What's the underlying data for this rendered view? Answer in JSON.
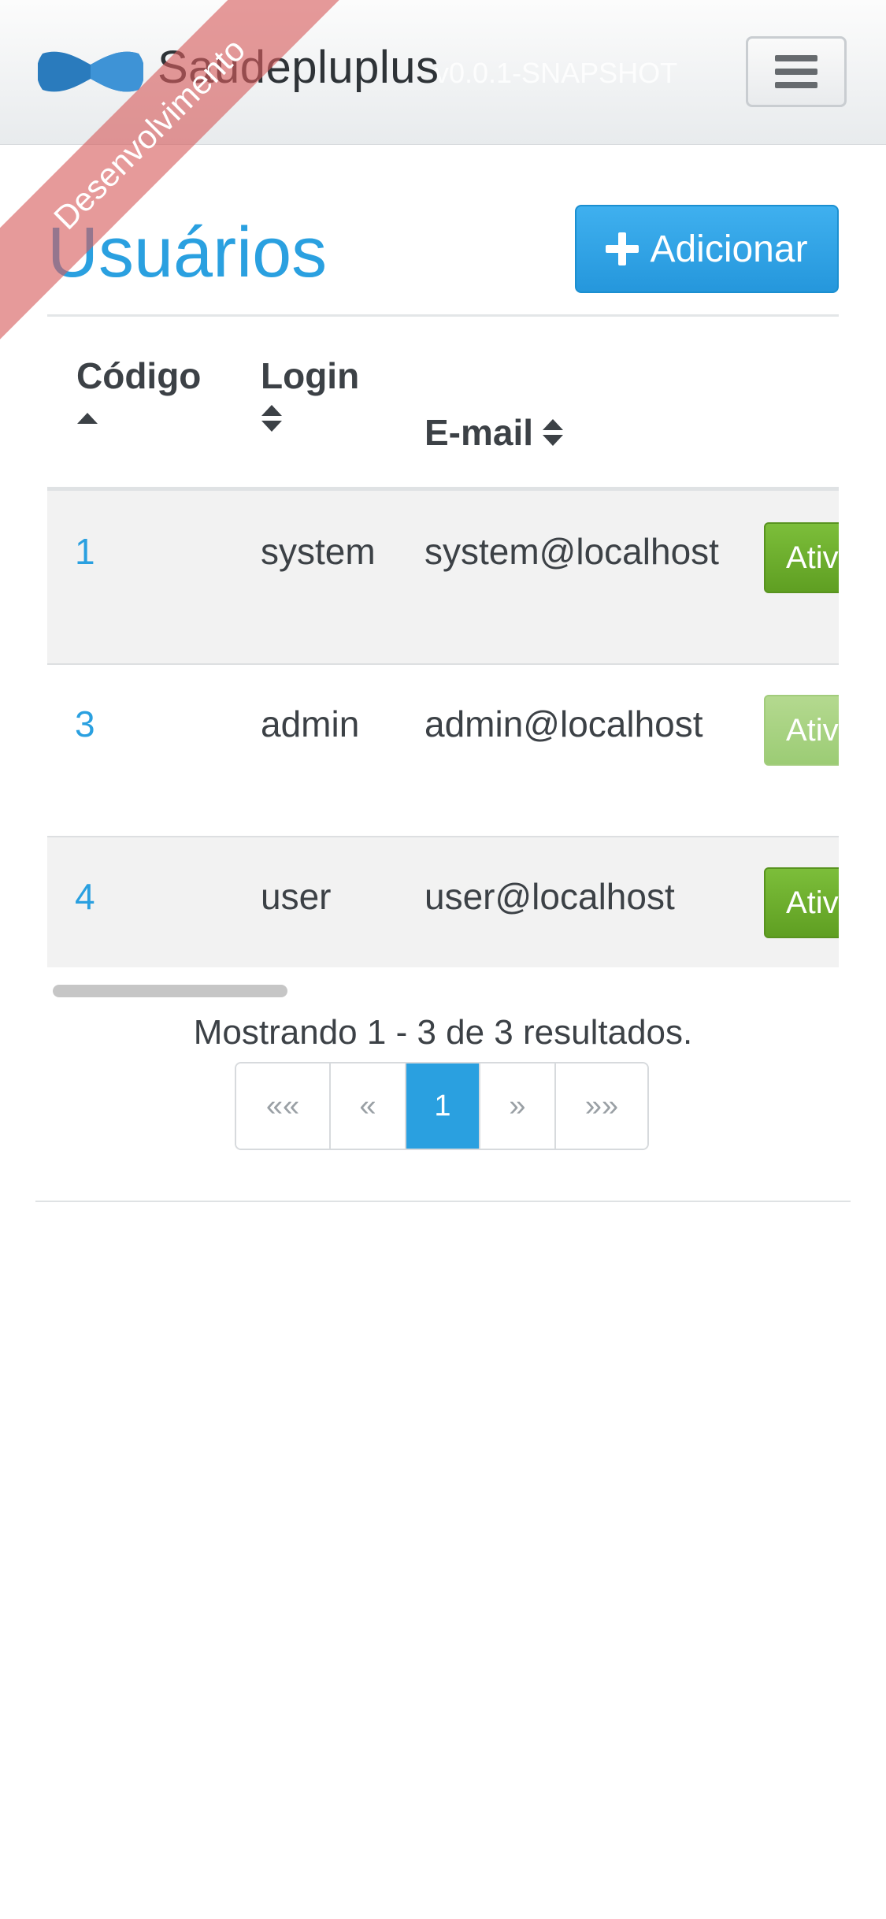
{
  "navbar": {
    "brand": "Saudepluplus",
    "version": "v0.0.1-SNAPSHOT",
    "logo_icon": "bowtie-logo-icon",
    "menu_icon": "hamburger-menu-icon"
  },
  "ribbon": {
    "text": "Desenvolvimento"
  },
  "page": {
    "title": "Usuários",
    "add_button_label": "Adicionar",
    "add_icon": "plus-icon"
  },
  "table": {
    "headers": {
      "code": "Código",
      "login": "Login",
      "email": "E-mail"
    },
    "rows": [
      {
        "code": "1",
        "login": "system",
        "email": "system@localhost",
        "status": "Ativo"
      },
      {
        "code": "3",
        "login": "admin",
        "email": "admin@localhost",
        "status": "Ativo"
      },
      {
        "code": "4",
        "login": "user",
        "email": "user@localhost",
        "status": "Ativo"
      }
    ]
  },
  "pagination": {
    "summary": "Mostrando 1 - 3 de 3 resultados.",
    "first": "««",
    "prev": "«",
    "current": "1",
    "next": "»",
    "last": "»»"
  },
  "colors": {
    "accent": "#2aa0e0",
    "status_active": "#5f9f22",
    "ribbon": "#d65c5c"
  }
}
